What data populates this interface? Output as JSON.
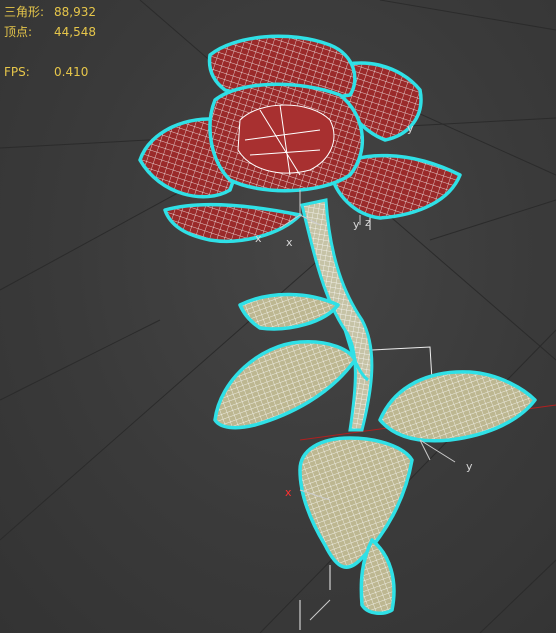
{
  "stats": {
    "triangles": {
      "label": "三角形:",
      "value": "88,932"
    },
    "vertices": {
      "label": "顶点:",
      "value": "44,548"
    },
    "fps": {
      "label": "FPS:",
      "value": "0.410"
    }
  },
  "gizmo": {
    "axis_x": "x",
    "axis_y": "y",
    "axis_z": "z"
  },
  "colors": {
    "background": "#3b3b3b",
    "grid": "#2a2a2a",
    "stats_text": "#e6c64a",
    "selection_outline": "#2fe0e6",
    "petal": "#9a2a2a",
    "leaf": "#c9c3a0",
    "wire": "#ffffff",
    "axis_x": "#ff3030"
  },
  "icons": [
    "transform-gizmo-icon"
  ]
}
